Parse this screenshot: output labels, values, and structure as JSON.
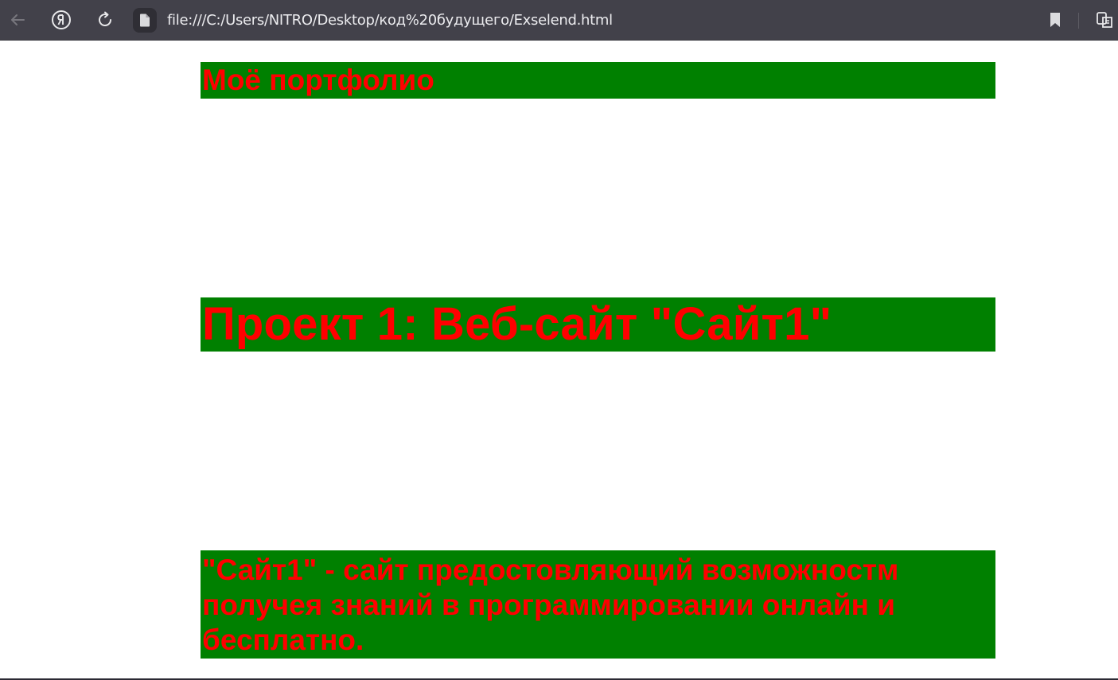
{
  "browser": {
    "url": "file:///C:/Users/NITRO/Desktop/код%20будущего/Exselend.html",
    "icons": {
      "back": "back-arrow-icon",
      "yandex": "yandex-logo-icon",
      "reload": "reload-icon",
      "file": "file-icon",
      "bookmark": "bookmark-icon",
      "extension": "extension-icon"
    },
    "colors": {
      "toolbar": "#42414a",
      "url_text": "#ececef"
    }
  },
  "page": {
    "heading": "Моё портфолио",
    "project_title": "Проект 1: Веб-сайт \"Сайт1\"",
    "description": "\"Сайт1\" - сайт предостовляющий возможностм получея знаний в программировании онлайн и бесплатно.",
    "colors": {
      "block_background": "#008000",
      "text": "#ff0000",
      "page_background": "#ffffff"
    }
  }
}
